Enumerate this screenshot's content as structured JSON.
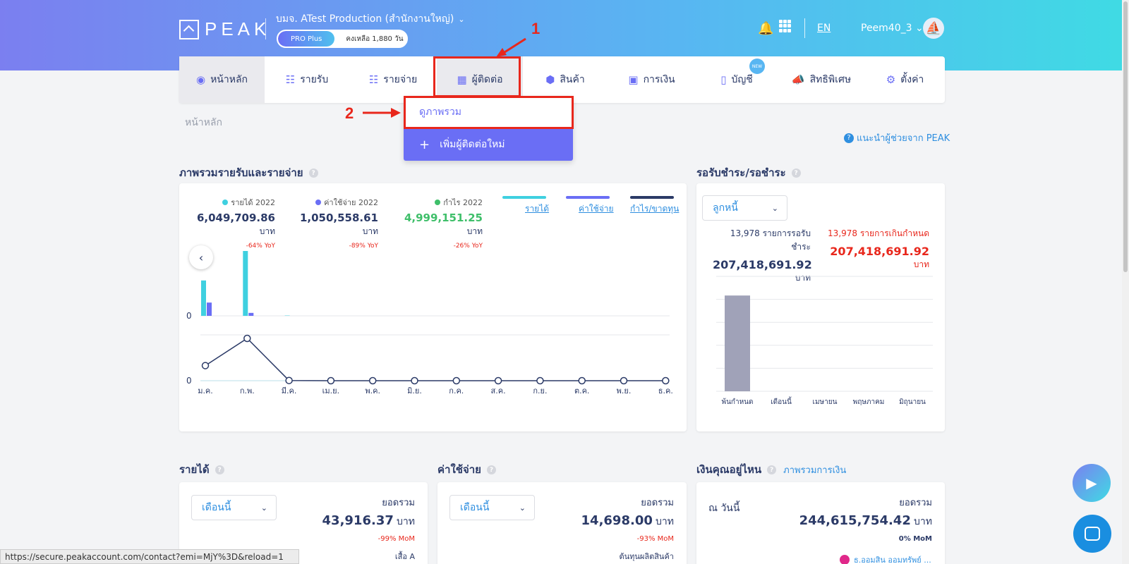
{
  "header": {
    "logo_text": "PEAK",
    "company": "บมจ. ATest Production (สำนักงานใหญ่)",
    "plan_tag": "PRO Plus",
    "plan_remaining": "คงเหลือ 1,880 วัน",
    "lang": "EN",
    "user": "Peem40_3"
  },
  "nav": {
    "items": [
      {
        "label": "หน้าหลัก",
        "icon": "dashboard-icon"
      },
      {
        "label": "รายรับ",
        "icon": "income-list-icon"
      },
      {
        "label": "รายจ่าย",
        "icon": "expense-list-icon"
      },
      {
        "label": "ผู้ติดต่อ",
        "icon": "contacts-icon"
      },
      {
        "label": "สินค้า",
        "icon": "box-icon"
      },
      {
        "label": "การเงิน",
        "icon": "money-icon"
      },
      {
        "label": "บัญชี",
        "icon": "book-icon"
      },
      {
        "label": "สิทธิพิเศษ",
        "icon": "megaphone-icon"
      },
      {
        "label": "ตั้งค่า",
        "icon": "gear-icon"
      }
    ],
    "new_badge": "NEW"
  },
  "dropdown": {
    "item1": "ดูภาพรวม",
    "item2": "เพิ่มผู้ติดต่อใหม่"
  },
  "annotations": {
    "one": "1",
    "two": "2"
  },
  "breadcrumb": "หน้าหลัก",
  "helper_link": "แนะนำผู้ช่วยจาก PEAK",
  "overview": {
    "title": "ภาพรวมรายรับและรายจ่าย",
    "stats": [
      {
        "label": "รายได้ 2022",
        "value": "6,049,709.86",
        "unit": "บาท",
        "yoy": "-64% YoY",
        "color": "#3fd0e0"
      },
      {
        "label": "ค่าใช้จ่าย 2022",
        "value": "1,050,558.61",
        "unit": "บาท",
        "yoy": "-89% YoY",
        "color": "#6a6ef5"
      },
      {
        "label": "กำไร 2022",
        "value": "4,999,151.25",
        "unit": "บาท",
        "yoy": "-26% YoY",
        "color": "#3fbf6a"
      }
    ],
    "legend": [
      "รายได้",
      "ค่าใช้จ่าย",
      "กำไร/ขาดทุน"
    ],
    "zero_top": "0",
    "zero_bottom": "0"
  },
  "receivables": {
    "title": "รอรับชำระ/รอชำระ",
    "select": "ลูกหนี้",
    "count_label": "13,978 รายการรอรับชำระ",
    "amount": "207,418,691.92",
    "unit": "บาท",
    "overdue_label": "13,978 รายการเกินกำหนด",
    "overdue_amount": "207,418,691.92",
    "overdue_unit": "บาท"
  },
  "income_card": {
    "title": "รายได้",
    "select": "เดือนนี้",
    "total_label": "ยอดรวม",
    "amount": "43,916.37",
    "unit": "บาท",
    "mom": "-99% MoM",
    "extra": "เสื้อ A"
  },
  "expense_card": {
    "title": "ค่าใช้จ่าย",
    "select": "เดือนนี้",
    "total_label": "ยอดรวม",
    "amount": "14,698.00",
    "unit": "บาท",
    "mom": "-93% MoM",
    "extra": "ต้นทุนผลิตสินค้า"
  },
  "money_card": {
    "title": "เงินคุณอยู่ไหน",
    "link": "ภาพรวมการเงิน",
    "today": "ณ วันนี้",
    "total_label": "ยอดรวม",
    "amount": "244,615,754.42",
    "unit": "บาท",
    "mom": "0% MoM",
    "extra": "ธ.ออมสิน ออมทรัพย์ ..."
  },
  "status_url": "https://secure.peakaccount.com/contact?emi=MjY%3D&reload=1",
  "chart_data": [
    {
      "type": "bar",
      "categories": [
        "ม.ค.",
        "ก.พ.",
        "มี.ค.",
        "เม.ย.",
        "พ.ค.",
        "มิ.ย.",
        "ก.ค.",
        "ส.ค.",
        "ก.ย.",
        "ต.ค.",
        "พ.ย.",
        "ธ.ค."
      ],
      "series": [
        {
          "name": "รายได้",
          "values": [
            2400000,
            4400000,
            20000,
            0,
            0,
            0,
            0,
            0,
            0,
            0,
            0,
            0
          ],
          "color": "#3fd0e0"
        },
        {
          "name": "ค่าใช้จ่าย",
          "values": [
            900000,
            200000,
            0,
            0,
            0,
            0,
            0,
            0,
            0,
            0,
            0,
            0
          ],
          "color": "#6a6ef5"
        }
      ]
    },
    {
      "type": "line",
      "categories": [
        "ม.ค.",
        "ก.พ.",
        "มี.ค.",
        "เม.ย.",
        "พ.ค.",
        "มิ.ย.",
        "ก.ค.",
        "ส.ค.",
        "ก.ย.",
        "ต.ค.",
        "พ.ย.",
        "ธ.ค."
      ],
      "series": [
        {
          "name": "กำไร/ขาดทุน",
          "values": [
            1500000,
            4200000,
            20000,
            0,
            0,
            0,
            0,
            0,
            0,
            0,
            0,
            0
          ],
          "color": "#2b3a67"
        }
      ]
    },
    {
      "type": "bar",
      "categories": [
        "พ้นกำหนด",
        "เดือนนี้",
        "เมษายน",
        "พฤษภาคม",
        "มิถุนายน"
      ],
      "series": [
        {
          "values": [
            207418691.92,
            0,
            0,
            0,
            0
          ],
          "color": "#a0a2b8"
        }
      ]
    }
  ]
}
